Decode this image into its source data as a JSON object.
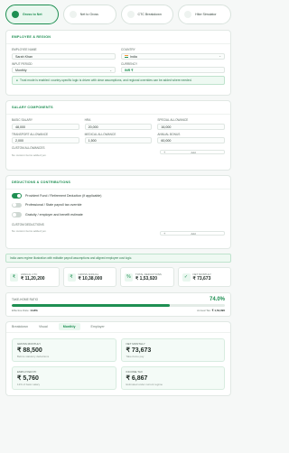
{
  "steps": [
    {
      "label": "Gross to Net"
    },
    {
      "label": "Net to Gross"
    },
    {
      "label": "CTC Breakdown"
    },
    {
      "label": "Hike Simulator"
    }
  ],
  "employee": {
    "heading": "Employee & Region",
    "name_label": "Employee name",
    "name_value": "Sarah Khan",
    "country_label": "Country",
    "country_value": "India",
    "period_label": "Input period",
    "period_value": "Monthly",
    "currency_label": "Currency",
    "currency_value": "INR ₹",
    "note": "Trust mode is enabled: country-specific logic is driven with clear assumptions, and regional overrides can be added where needed."
  },
  "salary": {
    "heading": "Salary Components",
    "basic_label": "Basic salary",
    "basic_value": "48,000",
    "hra_label": "HRA",
    "hra_value": "20,000",
    "special_label": "Special allowance",
    "special_value": "16,000",
    "transport_label": "Transport allowance",
    "transport_value": "2,000",
    "medical_label": "Medical allowance",
    "medical_value": "1,500",
    "bonus_label": "Annual bonus",
    "bonus_value": "60,000",
    "custom_label": "Custom allowances",
    "custom_empty": "No custom items added yet.",
    "add_label": "Add"
  },
  "deductions": {
    "heading": "Deductions & Contributions",
    "toggles": [
      {
        "label": "Provident Fund / Retirement Deduction (if applicable)",
        "on": true
      },
      {
        "label": "Professional / State payroll tax override",
        "on": false
      },
      {
        "label": "Gratuity / employer and benefit estimate",
        "on": false
      }
    ],
    "custom_label": "Custom deductions",
    "custom_empty": "No custom items added yet.",
    "add_label": "Add"
  },
  "banner": "India uses regime illustration with editable payroll assumptions and aligned employee cost logic.",
  "stats": [
    {
      "icon": "₹",
      "label": "Annual CTC",
      "value": "₹ 11,20,200"
    },
    {
      "icon": "₹",
      "label": "Gross annual",
      "value": "₹ 10,38,000"
    },
    {
      "icon": "%",
      "label": "Total deductions",
      "value": "₹ 1,53,920"
    },
    {
      "icon": "✓",
      "label": "Net monthly",
      "value": "₹ 73,673"
    }
  ],
  "ratio": {
    "label": "Take-home ratio",
    "percent": "74.0%",
    "fill": 0.74,
    "effective_label": "Effective Rate:",
    "effective_value": "14.8%",
    "annual_tax_label": "Annual Tax:",
    "annual_tax_value": "₹ 1,54,090"
  },
  "tabs": [
    {
      "label": "Breakdown"
    },
    {
      "label": "Visual"
    },
    {
      "label": "Monthly"
    },
    {
      "label": "Employer"
    }
  ],
  "results": [
    {
      "label": "Gross monthly",
      "value": "₹ 88,500",
      "sub": "Before statutory deductions"
    },
    {
      "label": "Net monthly",
      "value": "₹ 73,673",
      "sub": "Take-home pay"
    },
    {
      "label": "Employer PF",
      "value": "₹ 5,760",
      "sub": "12% of basic salary"
    },
    {
      "label": "Income tax",
      "value": "₹ 6,867",
      "sub": "Estimated under current regime"
    }
  ],
  "colors": {
    "accent": "#1e8f52",
    "accent_soft": "#e9f7ef"
  }
}
